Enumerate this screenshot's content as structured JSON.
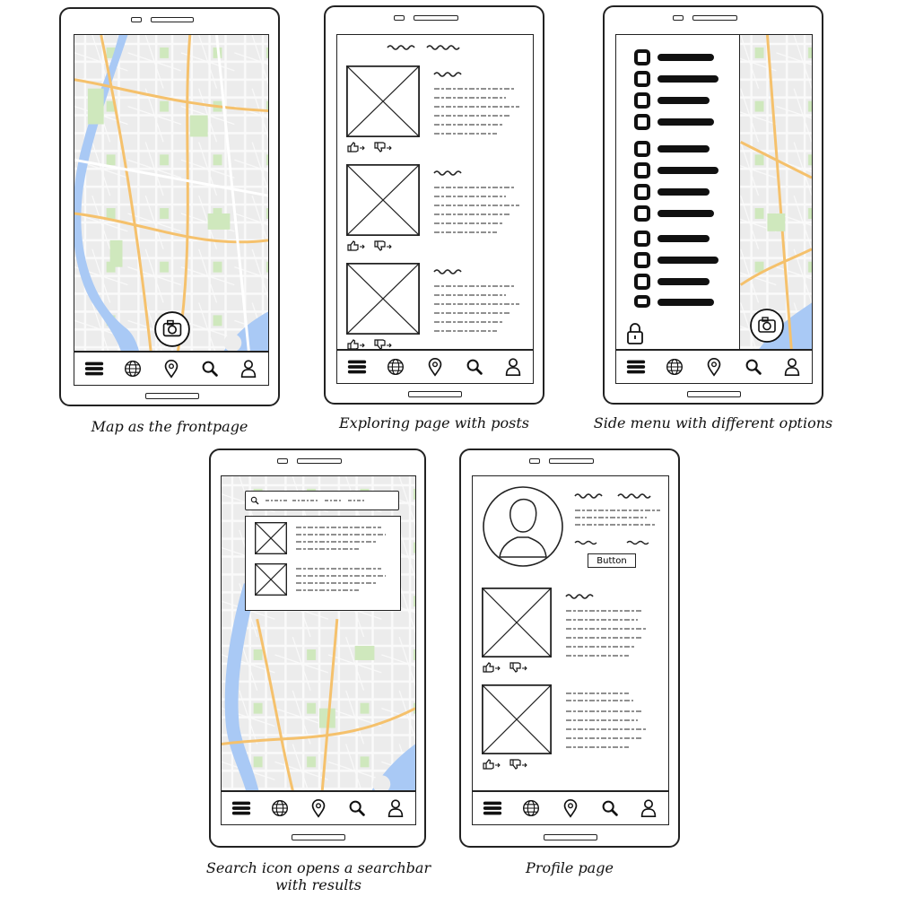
{
  "captions": {
    "map_frontpage": "Map as the frontpage",
    "exploring": "Exploring page with posts",
    "side_menu": "Side menu with different options",
    "search_line1": "Search icon opens a searchbar",
    "search_line2": "with results",
    "profile": "Profile page"
  },
  "profile": {
    "button_label": "Button"
  },
  "nav_icons": [
    "menu-icon",
    "globe-icon",
    "location-pin-icon",
    "search-icon",
    "user-icon"
  ],
  "colors": {
    "ink": "#222222",
    "map_land": "#eeeeee",
    "map_park": "#c8e6b0",
    "map_water": "#a9c9f5",
    "map_road": "#f5c16c"
  }
}
